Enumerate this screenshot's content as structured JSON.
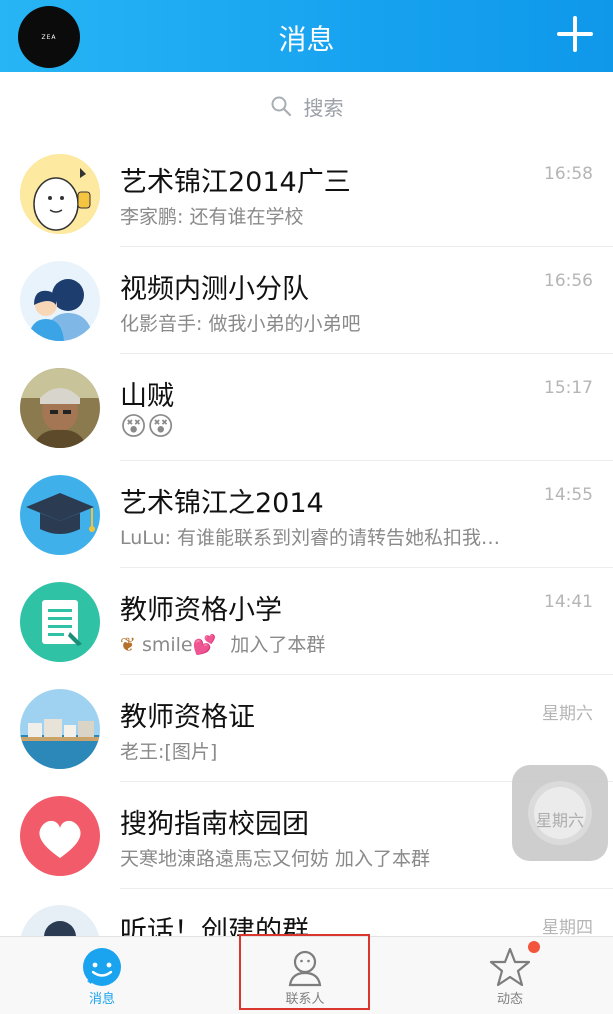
{
  "header": {
    "title": "消息",
    "avatar_text": "ZEA"
  },
  "search": {
    "placeholder": "搜索"
  },
  "conversations": [
    {
      "name": "艺术锦江2014广三",
      "message": "李家鹏: 还有谁在学校",
      "time": "16:58",
      "avatar": "cartoon-character-avatar"
    },
    {
      "name": "视频内测小分队",
      "message": "化影音手: 做我小弟的小弟吧",
      "time": "16:56",
      "avatar": "group-people-avatar"
    },
    {
      "name": "山贼",
      "message": "",
      "time": "15:17",
      "avatar": "person-photo-avatar",
      "emojis": [
        "😵",
        "😵"
      ]
    },
    {
      "name": "艺术锦江之2014",
      "message": "LuLu: 有谁能联系到刘睿的请转告她私扣我…",
      "time": "14:55",
      "avatar": "graduation-cap-avatar"
    },
    {
      "name": "教师资格小学",
      "message_prefix": "smile",
      "message": "加入了本群",
      "time": "14:41",
      "avatar": "document-avatar"
    },
    {
      "name": "教师资格证",
      "message": "老王:[图片]",
      "time": "星期六",
      "avatar": "landscape-photo-avatar"
    },
    {
      "name": "搜狗指南校园团",
      "message": "天寒地涷路遠馬忘又何妨 加入了本群",
      "time": "星期六",
      "avatar": "heart-avatar"
    },
    {
      "name": "听话！创建的群",
      "message": "",
      "time": "星期四",
      "avatar": "partial-avatar"
    }
  ],
  "float_widget": {
    "text": "星期六"
  },
  "tabbar": {
    "tabs": [
      {
        "label": "消息",
        "icon": "chat-smile-icon",
        "active": true
      },
      {
        "label": "联系人",
        "icon": "contacts-person-icon",
        "active": false
      },
      {
        "label": "动态",
        "icon": "star-icon",
        "active": false
      }
    ]
  },
  "colors": {
    "header": "#17a2ef",
    "accent": "#1aa3ee",
    "highlight_box": "#d9362e",
    "badge": "#f2553b"
  }
}
